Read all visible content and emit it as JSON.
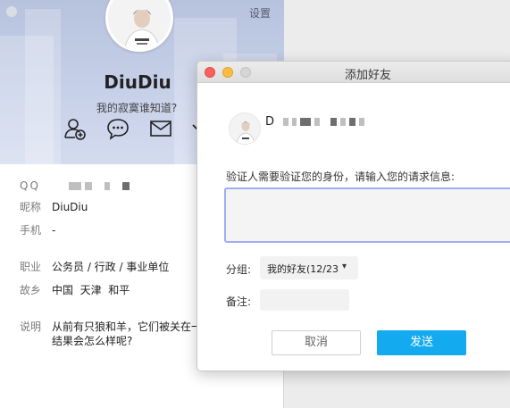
{
  "profile": {
    "settings_label": "设置",
    "nickname": "DiuDiu",
    "signature": "我的寂寞谁知道?",
    "actions": [
      {
        "icon": "add-friend-icon"
      },
      {
        "icon": "chat-bubble-icon"
      },
      {
        "icon": "mail-icon"
      }
    ],
    "fields": {
      "qq": {
        "label": "QQ"
      },
      "nickname": {
        "label": "昵称",
        "value": "DiuDiu"
      },
      "phone": {
        "label": "手机",
        "value": "-"
      },
      "job": {
        "label": "职业",
        "value": "公务员 / 行政 / 事业单位"
      },
      "hometown": {
        "label": "故乡",
        "value": "中国  天津  和平"
      },
      "description": {
        "label": "说明",
        "value": "从前有只狼和羊，它们被关在一结果会怎么样呢?"
      }
    }
  },
  "dialog": {
    "title": "添加好友",
    "user_initial": "D",
    "verify_prompt": "验证人需要验证您的身份，请输入您的请求信息:",
    "verify_value": "",
    "group_label": "分组:",
    "group_value": "我的好友(12/23",
    "note_label": "备注:",
    "note_value": "",
    "cancel_label": "取消",
    "send_label": "发送"
  },
  "colors": {
    "accent_blue": "#13aaf0",
    "input_focus_border": "#9faef3",
    "header_bg": "#c6d0e8",
    "traffic_close": "#fc605c",
    "traffic_minimize": "#fdbc40",
    "traffic_zoom": "#cfcfcf"
  }
}
